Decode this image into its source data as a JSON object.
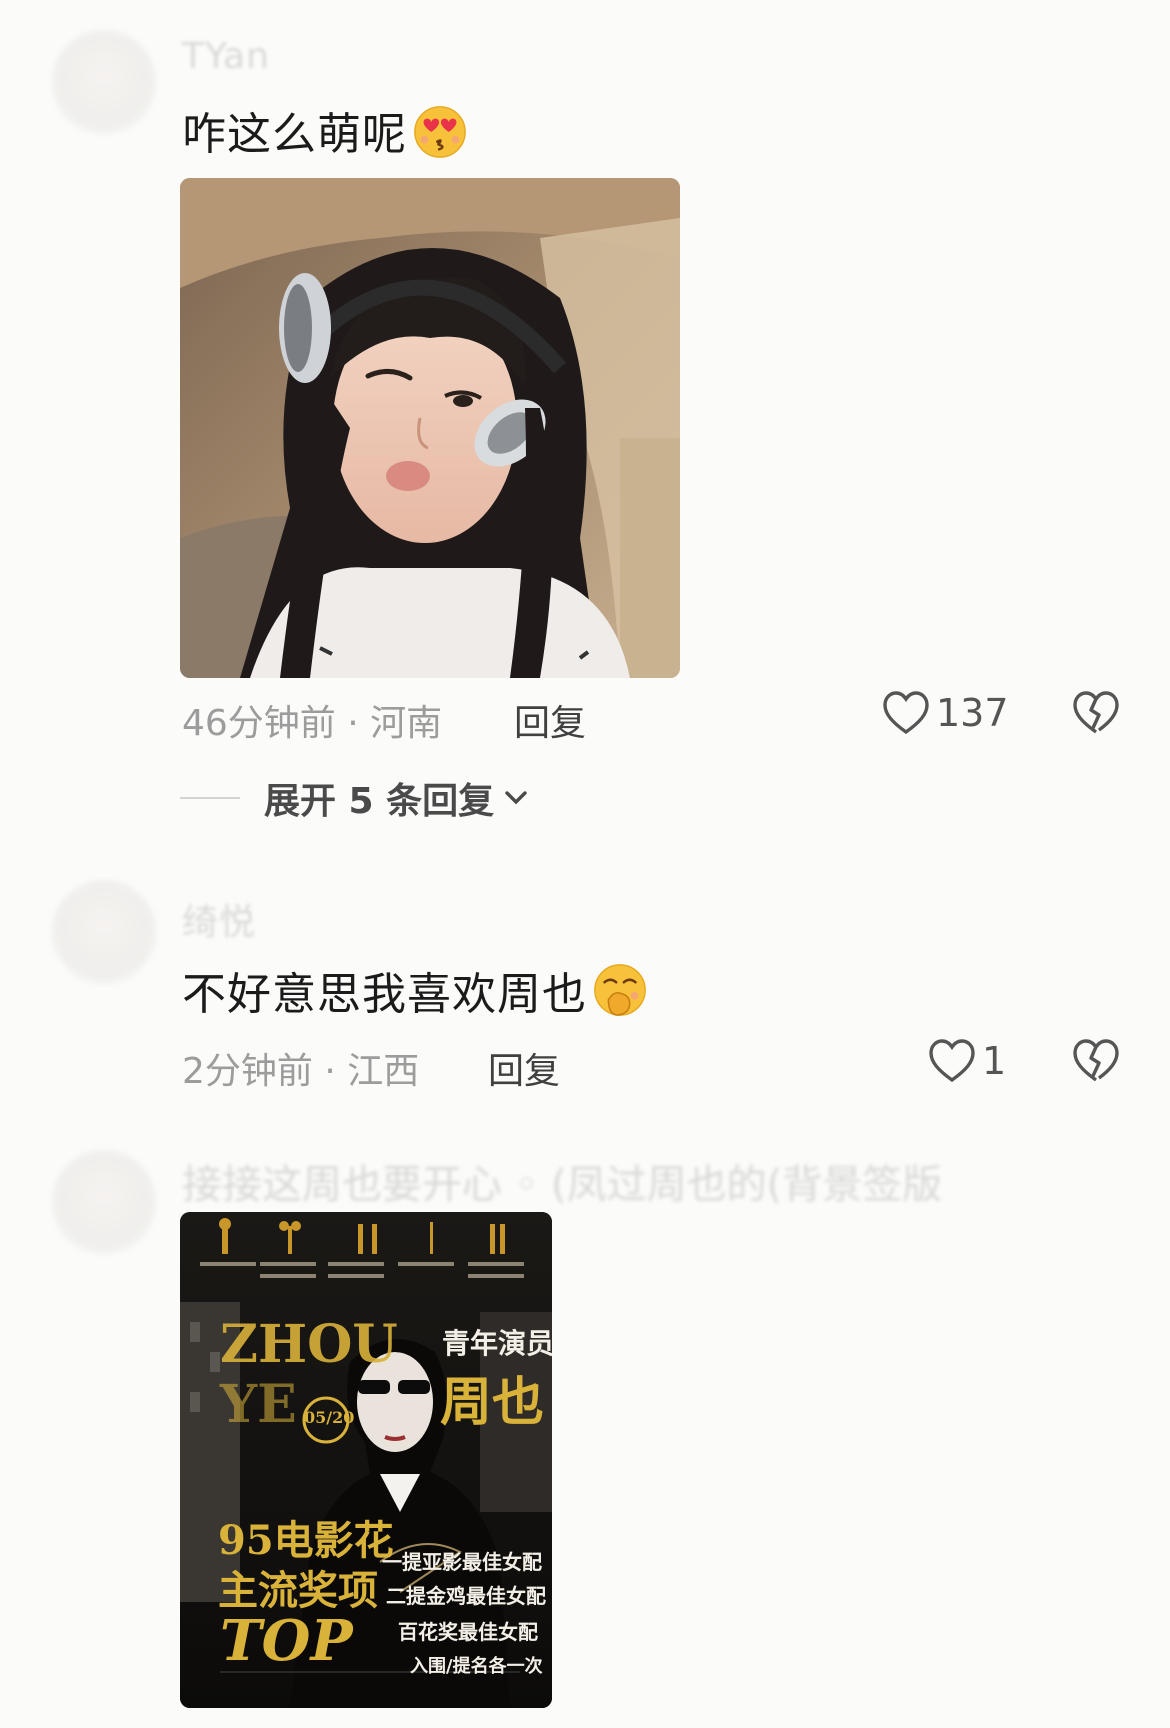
{
  "comments": [
    {
      "username": "TYan",
      "text": "咋这么萌呢",
      "emoji": "heart-eyes-kiss-emoji",
      "time": "46分钟前",
      "location": "河南",
      "reply_label": "回复",
      "likes": "137",
      "expand_label": "展开 5 条回复"
    },
    {
      "username": "绮悦",
      "text": "不好意思我喜欢周也",
      "emoji": "hand-over-mouth-emoji",
      "time": "2分钟前",
      "location": "江西",
      "reply_label": "回复",
      "likes": "1"
    },
    {
      "username": "",
      "text": "接接这周也要开心 ◦ (凤过周也的(背景签版",
      "poster": {
        "title_top": "青年演员",
        "name": "周也",
        "date": "05/20",
        "headline_1": "95电影花",
        "headline_2": "主流奖项",
        "headline_3": "TOP",
        "award_1": "一提亚影最佳女配",
        "award_2": "二提金鸡最佳女配",
        "award_3": "百花奖最佳女配",
        "award_4": "入围/提名各一次",
        "zhou_latin": "ZHOU YE"
      }
    }
  ],
  "colors": {
    "background": "#fbfbf9",
    "meta_text": "#9c9c9c",
    "poster_gold": "#d9b23a"
  }
}
